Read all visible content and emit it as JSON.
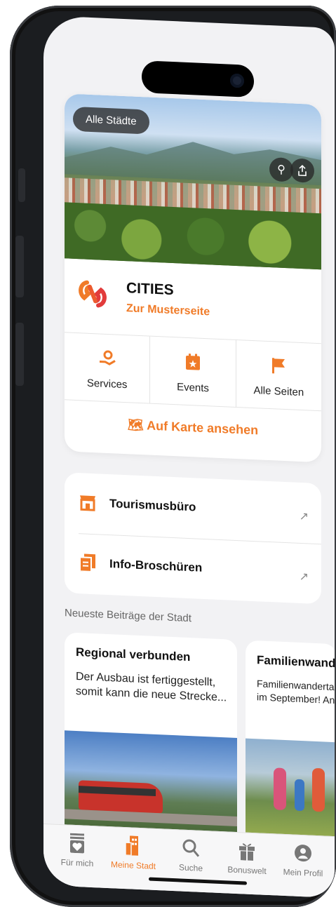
{
  "header": {
    "all_cities": "Alle Städte",
    "search_icon": "search-icon",
    "share_icon": "share-icon"
  },
  "city": {
    "name": "CITIES",
    "subtitle": "Zur Musterseite"
  },
  "quick_actions": [
    {
      "label": "Services",
      "icon": "hand-gear-icon"
    },
    {
      "label": "Events",
      "icon": "calendar-star-icon"
    },
    {
      "label": "Alle Seiten",
      "icon": "flag-icon"
    }
  ],
  "map_link": "Auf Karte ansehen",
  "links": [
    {
      "label": "Tourismusbüro",
      "icon": "store-icon"
    },
    {
      "label": "Info-Broschüren",
      "icon": "documents-icon"
    }
  ],
  "posts_section": "Neueste Beiträge der Stadt",
  "posts": [
    {
      "title": "Regional verbunden",
      "line1": "Der Ausbau ist fertiggestellt,",
      "line2": "somit kann die neue Strecke..."
    },
    {
      "title": "Familienwandert",
      "line1": "Familienwandertag",
      "line2": "im September! Anm"
    }
  ],
  "tabs": [
    {
      "label": "Für mich",
      "icon": "heart-box-icon"
    },
    {
      "label": "Meine Stadt",
      "icon": "building-icon"
    },
    {
      "label": "Suche",
      "icon": "search-icon"
    },
    {
      "label": "Bonuswelt",
      "icon": "gift-icon"
    },
    {
      "label": "Mein Profil",
      "icon": "profile-icon"
    }
  ],
  "colors": {
    "accent": "#f07b28",
    "background": "#f2f2f4"
  }
}
